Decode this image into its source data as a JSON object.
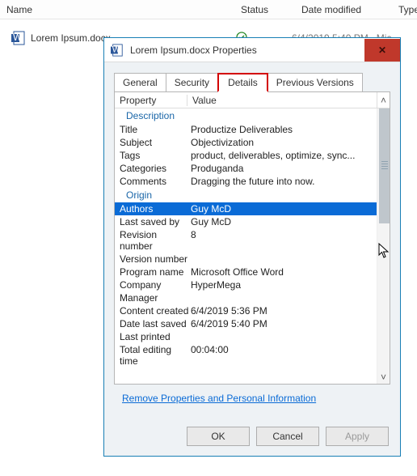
{
  "filelist": {
    "headers": {
      "name": "Name",
      "status": "Status",
      "date": "Date modified",
      "type": "Type"
    },
    "row": {
      "filename": "Lorem Ipsum.docx",
      "date": "6/4/2019 5:40 PM",
      "type": "Mic"
    }
  },
  "dialog": {
    "title": "Lorem Ipsum.docx Properties",
    "tabs": {
      "general": "General",
      "security": "Security",
      "details": "Details",
      "previous": "Previous Versions"
    },
    "prop_header": {
      "property": "Property",
      "value": "Value"
    },
    "sections": {
      "description": "Description",
      "origin": "Origin"
    },
    "desc": {
      "title_k": "Title",
      "title_v": "Productize Deliverables",
      "subject_k": "Subject",
      "subject_v": "Objectivization",
      "tags_k": "Tags",
      "tags_v": "product, deliverables, optimize, sync...",
      "categories_k": "Categories",
      "categories_v": "Produganda",
      "comments_k": "Comments",
      "comments_v": "Dragging the future into now."
    },
    "origin": {
      "authors_k": "Authors",
      "authors_v": "Guy McD",
      "lastsaved_k": "Last saved by",
      "lastsaved_v": "Guy McD",
      "rev_k": "Revision number",
      "rev_v": "8",
      "ver_k": "Version number",
      "ver_v": "",
      "prog_k": "Program name",
      "prog_v": "Microsoft Office Word",
      "company_k": "Company",
      "company_v": "HyperMega",
      "manager_k": "Manager",
      "manager_v": "",
      "created_k": "Content created",
      "created_v": "6/4/2019 5:36 PM",
      "saved_k": "Date last saved",
      "saved_v": "6/4/2019 5:40 PM",
      "printed_k": "Last printed",
      "printed_v": "",
      "edit_k": "Total editing time",
      "edit_v": "00:04:00"
    },
    "link": "Remove Properties and Personal Information",
    "buttons": {
      "ok": "OK",
      "cancel": "Cancel",
      "apply": "Apply"
    }
  },
  "glyphs": {
    "close": "✕",
    "up": "˄",
    "down": "˅",
    "check": "✓"
  }
}
